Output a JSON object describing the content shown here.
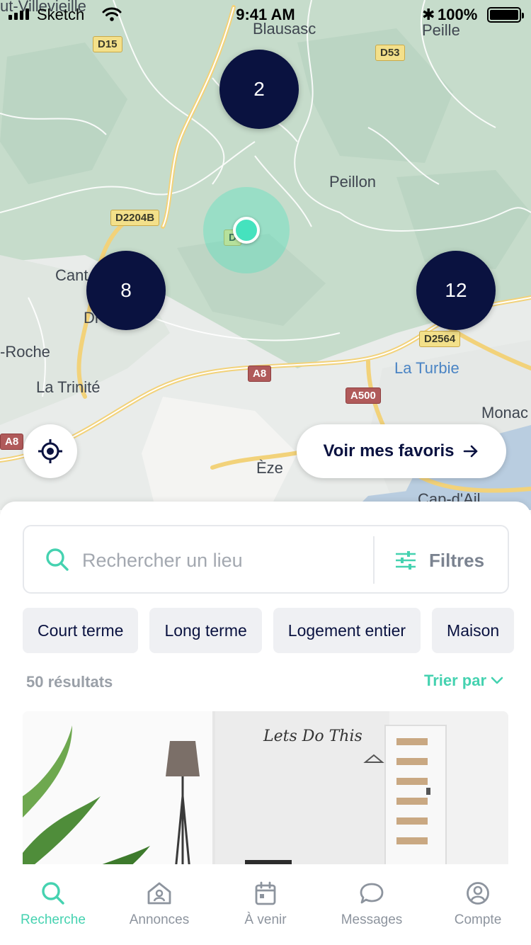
{
  "status_bar": {
    "carrier": "Sketch",
    "time": "9:41 AM",
    "battery": "100%"
  },
  "map": {
    "places": {
      "blausasc": "Blausasc",
      "peille": "Peille",
      "peillon": "Peillon",
      "cant": "Cant",
      "dr": "Dr",
      "roche": "-Roche",
      "la_trinite": "La Trinité",
      "la_turbie": "La Turbie",
      "eze": "Èze",
      "monac": "Monac",
      "cap_dail": "Cap-d'Ail",
      "villevieille": "ut-Villevieille"
    },
    "roads": {
      "d15": "D15",
      "d53": "D53",
      "d2204b": "D2204B",
      "d_small": "D",
      "d2564": "D2564",
      "a8_center": "A8",
      "a500": "A500",
      "a8_left": "A8"
    },
    "clusters": {
      "top": "2",
      "left": "8",
      "right": "12"
    },
    "favorites_button": "Voir mes favoris",
    "colors": {
      "cluster": "#0a1240",
      "user_dot": "#45e2be",
      "land": "#c9dcce"
    }
  },
  "search": {
    "placeholder": "Rechercher un lieu",
    "filters_label": "Filtres"
  },
  "chips": [
    "Court terme",
    "Long terme",
    "Logement entier",
    "Maison"
  ],
  "results": {
    "count_label": "50 résultats",
    "sort_label": "Trier par"
  },
  "listing": {
    "poster_text": "Lets Do This"
  },
  "tabs": [
    {
      "label": "Recherche",
      "icon": "search-icon",
      "active": true
    },
    {
      "label": "Annonces",
      "icon": "house-icon",
      "active": false
    },
    {
      "label": "À venir",
      "icon": "calendar-icon",
      "active": false
    },
    {
      "label": "Messages",
      "icon": "chat-bubble-icon",
      "active": false
    },
    {
      "label": "Compte",
      "icon": "user-icon",
      "active": false
    }
  ],
  "accent_color": "#45d2b0"
}
